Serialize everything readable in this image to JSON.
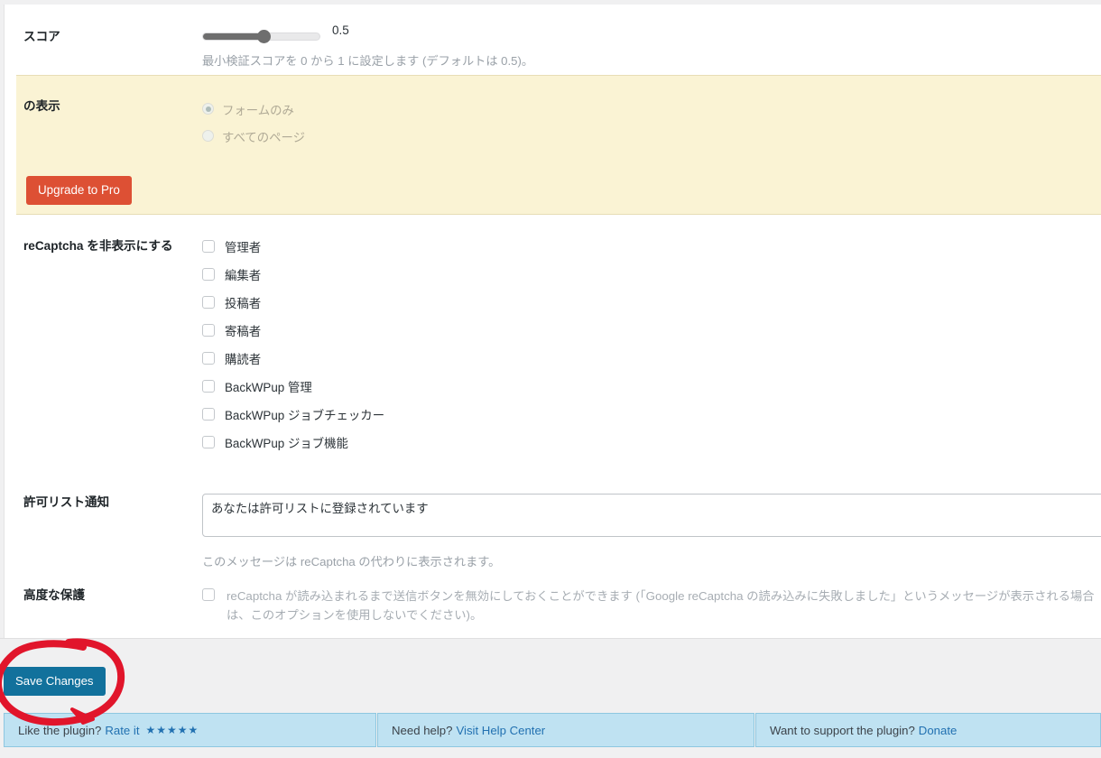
{
  "score": {
    "label": "スコア",
    "slider_value": "0.5",
    "slider_min": "0",
    "slider_max": "1",
    "description": "最小検証スコアを 0 から 1 に設定します (デフォルトは 0.5)。"
  },
  "display": {
    "label": "の表示",
    "options": [
      {
        "label": "フォームのみ",
        "selected": true
      },
      {
        "label": "すべてのページ",
        "selected": false
      }
    ],
    "upgrade_label": "Upgrade to Pro",
    "accent_color": "#dd5034",
    "panel_bg": "#faf3d4"
  },
  "hide_recaptcha": {
    "label": "reCaptcha を非表示にする",
    "roles": [
      {
        "label": "管理者",
        "checked": false
      },
      {
        "label": "編集者",
        "checked": false
      },
      {
        "label": "投稿者",
        "checked": false
      },
      {
        "label": "寄稿者",
        "checked": false
      },
      {
        "label": "購読者",
        "checked": false
      },
      {
        "label": "BackWPup 管理",
        "checked": false
      },
      {
        "label": "BackWPup ジョブチェッカー",
        "checked": false
      },
      {
        "label": "BackWPup ジョブ機能",
        "checked": false
      }
    ]
  },
  "whitelist_notice": {
    "label": "許可リスト通知",
    "value": "あなたは許可リストに登録されています",
    "description": "このメッセージは reCaptcha の代わりに表示されます。"
  },
  "advanced": {
    "label": "高度な保護",
    "checkbox_label": "reCaptcha が読み込まれるまで送信ボタンを無効にしておくことができます (「Google reCaptcha の読み込みに失敗しました」というメッセージが表示される場合は、このオプションを使用しないでください)。",
    "checked": false
  },
  "save_bar": {
    "save_label": "Save Changes",
    "button_color": "#12719c"
  },
  "footer": {
    "boxes": [
      {
        "text": "Like the plugin?",
        "link": "Rate it",
        "stars": "★★★★★"
      },
      {
        "text": "Need help?",
        "link": "Visit Help Center",
        "stars": ""
      },
      {
        "text": "Want to support the plugin?",
        "link": "Donate",
        "stars": ""
      }
    ],
    "bg_color": "#bfe2f2",
    "link_color": "#2271b1"
  },
  "annotation": {
    "type": "hand-drawn-circle",
    "color": "#e1152b",
    "target": "save-changes-button"
  }
}
